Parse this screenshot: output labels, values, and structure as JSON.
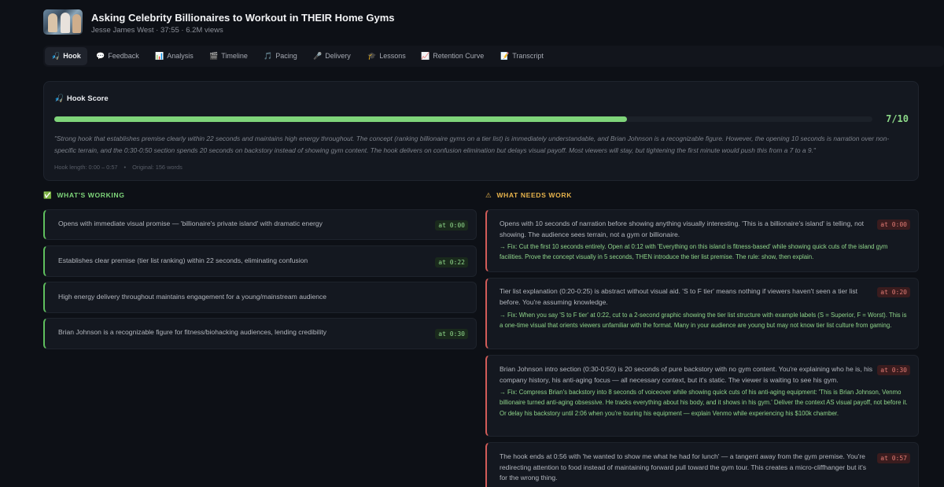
{
  "video": {
    "title": "Asking Celebrity Billionaires to Workout in THEIR Home Gyms",
    "meta": "Jesse James West · 37:55 · 6.2M views"
  },
  "tabs": [
    {
      "icon": "🎣",
      "label": "Hook"
    },
    {
      "icon": "💬",
      "label": "Feedback"
    },
    {
      "icon": "📊",
      "label": "Analysis"
    },
    {
      "icon": "🎬",
      "label": "Timeline"
    },
    {
      "icon": "🎵",
      "label": "Pacing"
    },
    {
      "icon": "🎤",
      "label": "Delivery"
    },
    {
      "icon": "🎓",
      "label": "Lessons"
    },
    {
      "icon": "📈",
      "label": "Retention Curve"
    },
    {
      "icon": "📝",
      "label": "Transcript"
    }
  ],
  "hook": {
    "icon": "🎣",
    "heading": "Hook Score",
    "score_text": "7/10",
    "score_fraction": 0.7,
    "summary": "\"Strong hook that establishes premise clearly within 22 seconds and maintains high energy throughout. The concept (ranking billionaire gyms on a tier list) is immediately understandable, and Brian Johnson is a recognizable figure. However, the opening 10 seconds is narration over non-specific terrain, and the 0:30-0:50 section spends 20 seconds on backstory instead of showing gym content. The hook delivers on confusion elimination but delays visual payoff. Most viewers will stay, but tightening the first minute would push this from a 7 to a 9.\"",
    "length": "Hook length: 0:00 – 0:57",
    "original": "Original: 156 words"
  },
  "working": {
    "icon": "✅",
    "heading": "WHAT'S WORKING",
    "items": [
      {
        "text": "Opens with immediate visual promise — 'billionaire's private island' with dramatic energy",
        "time": "at 0:00"
      },
      {
        "text": "Establishes clear premise (tier list ranking) within 22 seconds, eliminating confusion",
        "time": "at 0:22"
      },
      {
        "text": "High energy delivery throughout maintains engagement for a young/mainstream audience",
        "time": ""
      },
      {
        "text": "Brian Johnson is a recognizable figure for fitness/biohacking audiences, lending credibility",
        "time": "at 0:30"
      }
    ]
  },
  "needs_work": {
    "icon": "⚠",
    "heading": "WHAT NEEDS WORK",
    "items": [
      {
        "text": "Opens with 10 seconds of narration before showing anything visually interesting. 'This is a billionaire's island' is telling, not showing. The audience sees terrain, not a gym or billionaire.",
        "fix": "→ Fix: Cut the first 10 seconds entirely. Open at 0:12 with 'Everything on this island is fitness-based' while showing quick cuts of the island gym facilities. Prove the concept visually in 5 seconds, THEN introduce the tier list premise. The rule: show, then explain.",
        "time": "at 0:00"
      },
      {
        "text": "Tier list explanation (0:20-0:25) is abstract without visual aid. 'S to F tier' means nothing if viewers haven't seen a tier list before. You're assuming knowledge.",
        "fix": "→ Fix: When you say 'S to F tier' at 0:22, cut to a 2-second graphic showing the tier list structure with example labels (S = Superior, F = Worst). This is a one-time visual that orients viewers unfamiliar with the format. Many in your audience are young but may not know tier list culture from gaming.",
        "time": "at 0:20"
      },
      {
        "text": "Brian Johnson intro section (0:30-0:50) is 20 seconds of pure backstory with no gym content. You're explaining who he is, his company history, his anti-aging focus — all necessary context, but it's static. The viewer is waiting to see his gym.",
        "fix": "→ Fix: Compress Brian's backstory into 8 seconds of voiceover while showing quick cuts of his anti-aging equipment: 'This is Brian Johnson, Venmo billionaire turned anti-aging obsessive. He tracks everything about his body, and it shows in his gym.' Deliver the context AS visual payoff, not before it. Or delay his backstory until 2:06 when you're touring his equipment — explain Venmo while experiencing his $100k chamber.",
        "time": "at 0:30"
      },
      {
        "text": "The hook ends at 0:56 with 'he wanted to show me what he had for lunch' — a tangent away from the gym premise. You're redirecting attention to food instead of maintaining forward pull toward the gym tour. This creates a micro-cliffhanger but it's for the wrong thing.",
        "fix": "",
        "time": "at 0:57"
      }
    ]
  }
}
